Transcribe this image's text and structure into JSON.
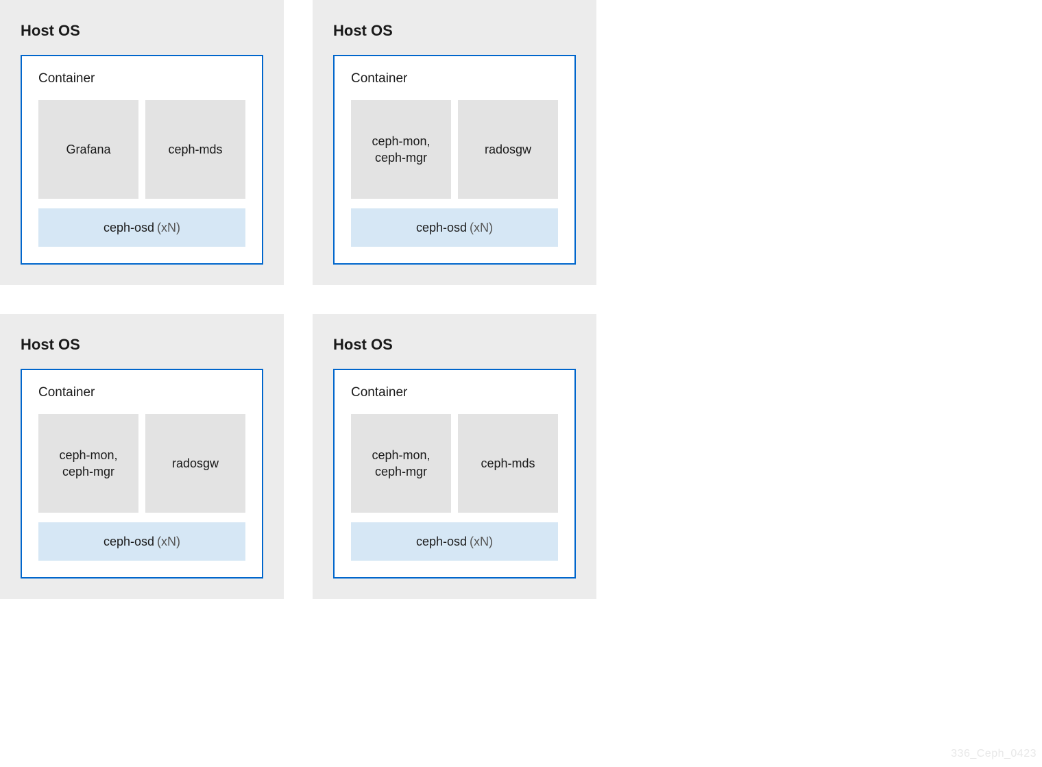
{
  "hosts": [
    {
      "title": "Host OS",
      "container_label": "Container",
      "services": [
        "Grafana",
        "ceph-mds"
      ],
      "osd_label": "ceph-osd",
      "osd_suffix": "(xN)"
    },
    {
      "title": "Host OS",
      "container_label": "Container",
      "services": [
        "ceph-mon,\nceph-mgr",
        "radosgw"
      ],
      "osd_label": "ceph-osd",
      "osd_suffix": "(xN)"
    },
    {
      "title": "Host OS",
      "container_label": "Container",
      "services": [
        "ceph-mon,\nceph-mgr",
        "radosgw"
      ],
      "osd_label": "ceph-osd",
      "osd_suffix": "(xN)"
    },
    {
      "title": "Host OS",
      "container_label": "Container",
      "services": [
        "ceph-mon,\nceph-mgr",
        "ceph-mds"
      ],
      "osd_label": "ceph-osd",
      "osd_suffix": "(xN)"
    }
  ],
  "watermark": "336_Ceph_0423",
  "colors": {
    "panel_bg": "#ececec",
    "container_border": "#0066cc",
    "service_bg": "#e3e3e3",
    "osd_bg": "#d6e7f5"
  }
}
